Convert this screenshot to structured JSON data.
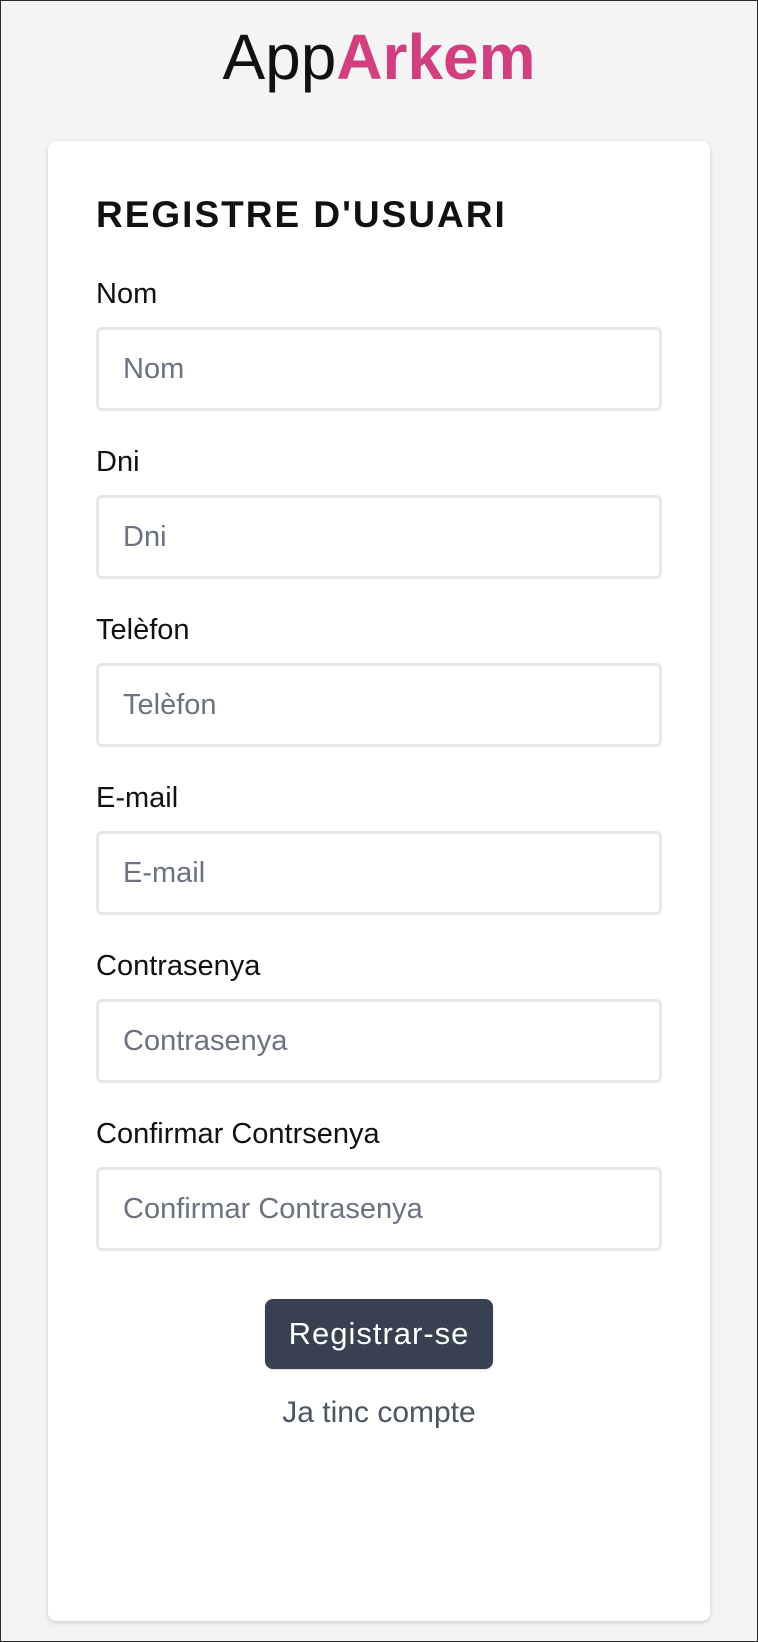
{
  "logo": {
    "app": "App",
    "brand": "Arkem"
  },
  "form": {
    "title": "REGISTRE D'USUARI",
    "fields": [
      {
        "label": "Nom",
        "placeholder": "Nom",
        "value": ""
      },
      {
        "label": "Dni",
        "placeholder": "Dni",
        "value": ""
      },
      {
        "label": "Telèfon",
        "placeholder": "Telèfon",
        "value": ""
      },
      {
        "label": "E-mail",
        "placeholder": "E-mail",
        "value": ""
      },
      {
        "label": "Contrasenya",
        "placeholder": "Contrasenya",
        "value": ""
      },
      {
        "label": "Confirmar Contrsenya",
        "placeholder": "Confirmar Contrasenya",
        "value": ""
      }
    ],
    "submit_label": "Registrar-se",
    "login_link": "Ja tinc compte"
  },
  "colors": {
    "brand": "#d13f7f",
    "button": "#374151",
    "background": "#f4f4f5",
    "input_border": "#e5e7eb"
  }
}
